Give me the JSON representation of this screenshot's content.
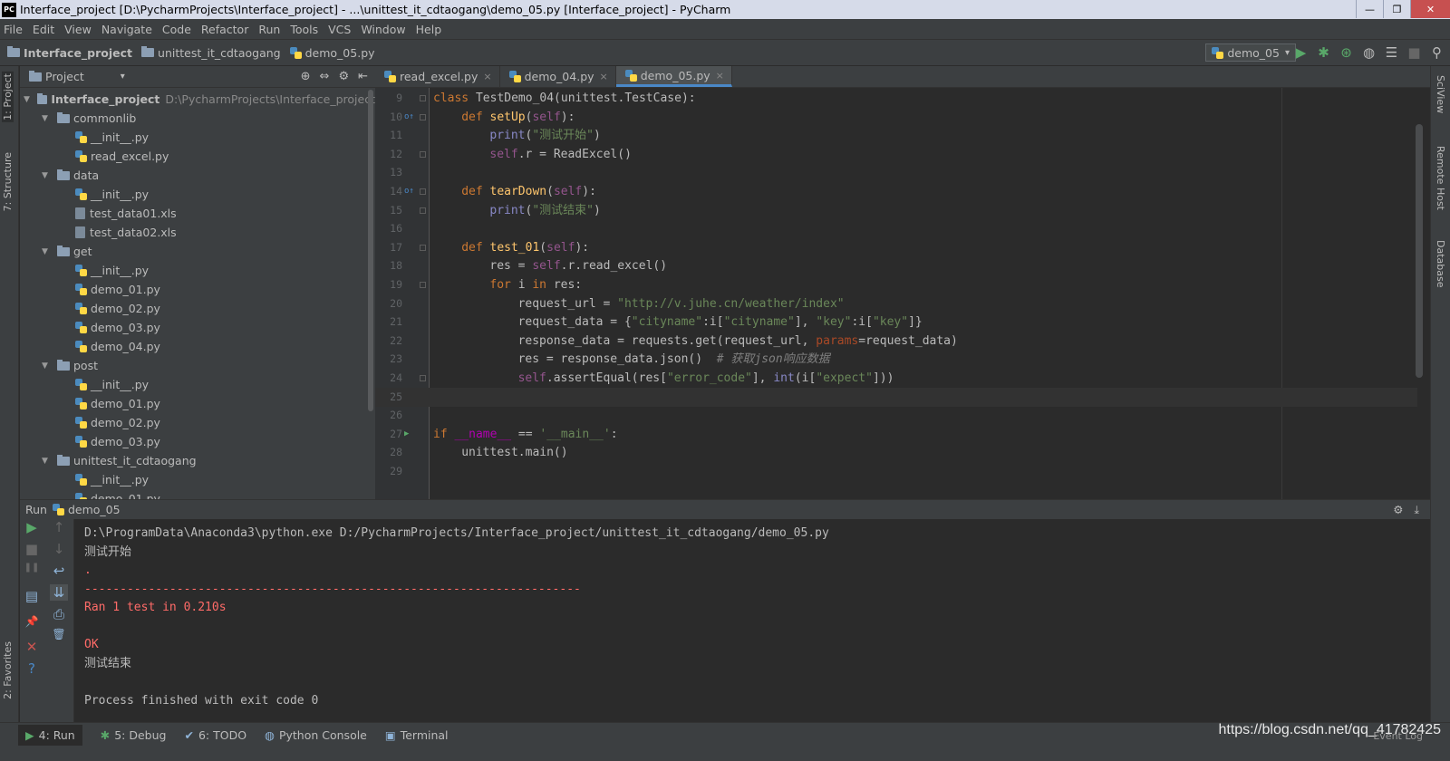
{
  "window": {
    "title": "Interface_project [D:\\PycharmProjects\\Interface_project] - ...\\unittest_it_cdtaogang\\demo_05.py [Interface_project] - PyCharm",
    "logo": "PC",
    "minimize": "—",
    "restore": "❐",
    "close": "✕"
  },
  "menu": [
    "File",
    "Edit",
    "View",
    "Navigate",
    "Code",
    "Refactor",
    "Run",
    "Tools",
    "VCS",
    "Window",
    "Help"
  ],
  "breadcrumb": {
    "project": "Interface_project",
    "folder": "unittest_it_cdtaogang",
    "file": "demo_05.py"
  },
  "run_config": {
    "label": "demo_05",
    "arrow": "▾"
  },
  "toolbar_icons": {
    "run": "▶",
    "debug": "✱",
    "coverage": "⊛",
    "profile": "◍",
    "build": "☰",
    "stop": "■",
    "search": "⚲"
  },
  "sidebar": {
    "left": {
      "project": "1: Project",
      "structure": "7: Structure",
      "favorites": "2: Favorites"
    },
    "right": {
      "sciview": "SciView",
      "remote": "Remote Host",
      "database": "Database"
    }
  },
  "project_panel": {
    "title": "Project",
    "dropdown": "▾",
    "icons": {
      "locate": "⊕",
      "collapse": "⇔",
      "settings": "⚙",
      "hide": "⇤"
    },
    "root": {
      "name": "Interface_project",
      "path": "D:\\PycharmProjects\\Interface_project"
    },
    "tree": [
      {
        "depth": 1,
        "type": "folder",
        "name": "commonlib",
        "expanded": true
      },
      {
        "depth": 2,
        "type": "py",
        "name": "__init__.py"
      },
      {
        "depth": 2,
        "type": "py",
        "name": "read_excel.py"
      },
      {
        "depth": 1,
        "type": "folder",
        "name": "data",
        "expanded": true
      },
      {
        "depth": 2,
        "type": "py",
        "name": "__init__.py"
      },
      {
        "depth": 2,
        "type": "file",
        "name": "test_data01.xls"
      },
      {
        "depth": 2,
        "type": "file",
        "name": "test_data02.xls"
      },
      {
        "depth": 1,
        "type": "folder",
        "name": "get",
        "expanded": true
      },
      {
        "depth": 2,
        "type": "py",
        "name": "__init__.py"
      },
      {
        "depth": 2,
        "type": "py",
        "name": "demo_01.py"
      },
      {
        "depth": 2,
        "type": "py",
        "name": "demo_02.py"
      },
      {
        "depth": 2,
        "type": "py",
        "name": "demo_03.py"
      },
      {
        "depth": 2,
        "type": "py",
        "name": "demo_04.py"
      },
      {
        "depth": 1,
        "type": "folder",
        "name": "post",
        "expanded": true
      },
      {
        "depth": 2,
        "type": "py",
        "name": "__init__.py"
      },
      {
        "depth": 2,
        "type": "py",
        "name": "demo_01.py"
      },
      {
        "depth": 2,
        "type": "py",
        "name": "demo_02.py"
      },
      {
        "depth": 2,
        "type": "py",
        "name": "demo_03.py"
      },
      {
        "depth": 1,
        "type": "folder",
        "name": "unittest_it_cdtaogang",
        "expanded": true
      },
      {
        "depth": 2,
        "type": "py",
        "name": "__init__.py"
      },
      {
        "depth": 2,
        "type": "py",
        "name": "demo_01.py"
      }
    ]
  },
  "editor_tabs": [
    {
      "label": "read_excel.py",
      "active": false,
      "close": "×"
    },
    {
      "label": "demo_04.py",
      "active": false,
      "close": "×"
    },
    {
      "label": "demo_05.py",
      "active": true,
      "close": "×"
    }
  ],
  "code": [
    {
      "n": "9",
      "mark": "",
      "fold": true,
      "current": false,
      "tokens": [
        [
          "kw",
          "class "
        ],
        [
          "",
          "TestDemo_04(unittest.TestCase):"
        ]
      ]
    },
    {
      "n": "10",
      "mark": "o↑",
      "fold": true,
      "current": false,
      "tokens": [
        [
          "ind4",
          ""
        ],
        [
          "kw",
          "def "
        ],
        [
          "fn",
          "setUp"
        ],
        [
          "",
          "("
        ],
        [
          "sf",
          "self"
        ],
        [
          "",
          "):"
        ]
      ]
    },
    {
      "n": "11",
      "mark": "",
      "fold": false,
      "current": false,
      "tokens": [
        [
          "ind8",
          ""
        ],
        [
          "bi",
          "print"
        ],
        [
          "",
          "("
        ],
        [
          "st",
          "\"测试开始\""
        ],
        [
          "",
          ")"
        ]
      ]
    },
    {
      "n": "12",
      "mark": "",
      "fold": true,
      "current": false,
      "tokens": [
        [
          "ind8",
          ""
        ],
        [
          "sf",
          "self"
        ],
        [
          "",
          ".r = ReadExcel()"
        ]
      ]
    },
    {
      "n": "13",
      "mark": "",
      "fold": false,
      "current": false,
      "tokens": []
    },
    {
      "n": "14",
      "mark": "o↑",
      "fold": true,
      "current": false,
      "tokens": [
        [
          "ind4",
          ""
        ],
        [
          "kw",
          "def "
        ],
        [
          "fn",
          "tearDown"
        ],
        [
          "",
          "("
        ],
        [
          "sf",
          "self"
        ],
        [
          "",
          "):"
        ]
      ]
    },
    {
      "n": "15",
      "mark": "",
      "fold": true,
      "current": false,
      "tokens": [
        [
          "ind8",
          ""
        ],
        [
          "bi",
          "print"
        ],
        [
          "",
          "("
        ],
        [
          "st",
          "\"测试结束\""
        ],
        [
          "",
          ")"
        ]
      ]
    },
    {
      "n": "16",
      "mark": "",
      "fold": false,
      "current": false,
      "tokens": []
    },
    {
      "n": "17",
      "mark": "",
      "fold": true,
      "current": false,
      "tokens": [
        [
          "ind4",
          ""
        ],
        [
          "kw",
          "def "
        ],
        [
          "fn",
          "test_01"
        ],
        [
          "",
          "("
        ],
        [
          "sf",
          "self"
        ],
        [
          "",
          "):"
        ]
      ]
    },
    {
      "n": "18",
      "mark": "",
      "fold": false,
      "current": false,
      "tokens": [
        [
          "ind8",
          ""
        ],
        [
          "",
          "res = "
        ],
        [
          "sf",
          "self"
        ],
        [
          "",
          ".r.read_excel()"
        ]
      ]
    },
    {
      "n": "19",
      "mark": "",
      "fold": true,
      "current": false,
      "tokens": [
        [
          "ind8",
          ""
        ],
        [
          "kw",
          "for "
        ],
        [
          "",
          "i "
        ],
        [
          "kw",
          "in "
        ],
        [
          "",
          "res:"
        ]
      ]
    },
    {
      "n": "20",
      "mark": "",
      "fold": false,
      "current": false,
      "tokens": [
        [
          "ind12",
          ""
        ],
        [
          "",
          "request_url = "
        ],
        [
          "st",
          "\"http://v.juhe.cn/weather/index\""
        ]
      ]
    },
    {
      "n": "21",
      "mark": "",
      "fold": false,
      "current": false,
      "tokens": [
        [
          "ind12",
          ""
        ],
        [
          "",
          "request_data = {"
        ],
        [
          "st",
          "\"cityname\""
        ],
        [
          "",
          ":i["
        ],
        [
          "st",
          "\"cityname\""
        ],
        [
          "",
          "], "
        ],
        [
          "st",
          "\"key\""
        ],
        [
          "",
          ":i["
        ],
        [
          "st",
          "\"key\""
        ],
        [
          "",
          "]}"
        ]
      ]
    },
    {
      "n": "22",
      "mark": "",
      "fold": false,
      "current": false,
      "tokens": [
        [
          "ind12",
          ""
        ],
        [
          "",
          "response_data = requests.get(request_url, "
        ],
        [
          "pm",
          "params"
        ],
        [
          "",
          "=request_data)"
        ]
      ]
    },
    {
      "n": "23",
      "mark": "",
      "fold": false,
      "current": false,
      "tokens": [
        [
          "ind12",
          ""
        ],
        [
          "",
          "res = response_data.json()  "
        ],
        [
          "cm",
          "# 获取json响应数据"
        ]
      ]
    },
    {
      "n": "24",
      "mark": "",
      "fold": true,
      "current": false,
      "tokens": [
        [
          "ind12",
          ""
        ],
        [
          "sf",
          "self"
        ],
        [
          "",
          ".assertEqual(res["
        ],
        [
          "st",
          "\"error_code\""
        ],
        [
          "",
          "], "
        ],
        [
          "bi",
          "int"
        ],
        [
          "",
          "(i["
        ],
        [
          "st",
          "\"expect\""
        ],
        [
          "",
          "]))"
        ]
      ]
    },
    {
      "n": "25",
      "mark": "",
      "fold": false,
      "current": true,
      "tokens": []
    },
    {
      "n": "26",
      "mark": "",
      "fold": false,
      "current": false,
      "tokens": []
    },
    {
      "n": "27",
      "mark": "▶",
      "fold": false,
      "current": false,
      "tokens": [
        [
          "kw",
          "if "
        ],
        [
          "dn",
          "__name__"
        ],
        [
          "",
          " == "
        ],
        [
          "st",
          "'__main__'"
        ],
        [
          "",
          ":"
        ]
      ]
    },
    {
      "n": "28",
      "mark": "",
      "fold": false,
      "current": false,
      "tokens": [
        [
          "ind4",
          ""
        ],
        [
          "",
          "unittest.main()"
        ]
      ]
    },
    {
      "n": "29",
      "mark": "",
      "fold": false,
      "current": false,
      "tokens": []
    }
  ],
  "run_panel": {
    "label": "Run",
    "config": "demo_05",
    "icons": {
      "settings": "⚙",
      "hide": "⤓"
    },
    "tools": {
      "rerun": "▶",
      "stop": "■",
      "pause": "❚❚",
      "layout": "▤",
      "pin": "📌",
      "close": "✕",
      "help": "?",
      "up": "↑",
      "down": "↓",
      "wrap": "↩",
      "scroll": "⇊",
      "print": "⎙",
      "trash": "🗑"
    },
    "output": [
      {
        "text": "D:\\ProgramData\\Anaconda3\\python.exe D:/PycharmProjects/Interface_project/unittest_it_cdtaogang/demo_05.py",
        "err": false
      },
      {
        "text": "测试开始",
        "err": false
      },
      {
        "text": ".",
        "err": true
      },
      {
        "text": "----------------------------------------------------------------------",
        "err": true
      },
      {
        "text": "Ran 1 test in 0.210s",
        "err": true
      },
      {
        "text": "",
        "err": true
      },
      {
        "text": "OK",
        "err": true
      },
      {
        "text": "测试结束",
        "err": false
      },
      {
        "text": "",
        "err": false
      },
      {
        "text": "Process finished with exit code 0",
        "err": false
      }
    ]
  },
  "bottom_tabs": [
    {
      "icon": "▶",
      "label": "4: Run",
      "active": true
    },
    {
      "icon": "✱",
      "label": "5: Debug",
      "active": false
    },
    {
      "icon": "✔",
      "label": "6: TODO",
      "active": false
    },
    {
      "icon": "◍",
      "label": "Python Console",
      "active": false
    },
    {
      "icon": "▣",
      "label": "Terminal",
      "active": false
    }
  ],
  "event_log": "Event Log",
  "watermark": "https://blog.csdn.net/qq_41782425",
  "colors": {
    "keyword": "#cc7832",
    "function": "#ffc66d",
    "self": "#94558d",
    "string": "#6a8759",
    "comment": "#808080",
    "error": "#ff6b68",
    "accent": "#4a88c7"
  }
}
